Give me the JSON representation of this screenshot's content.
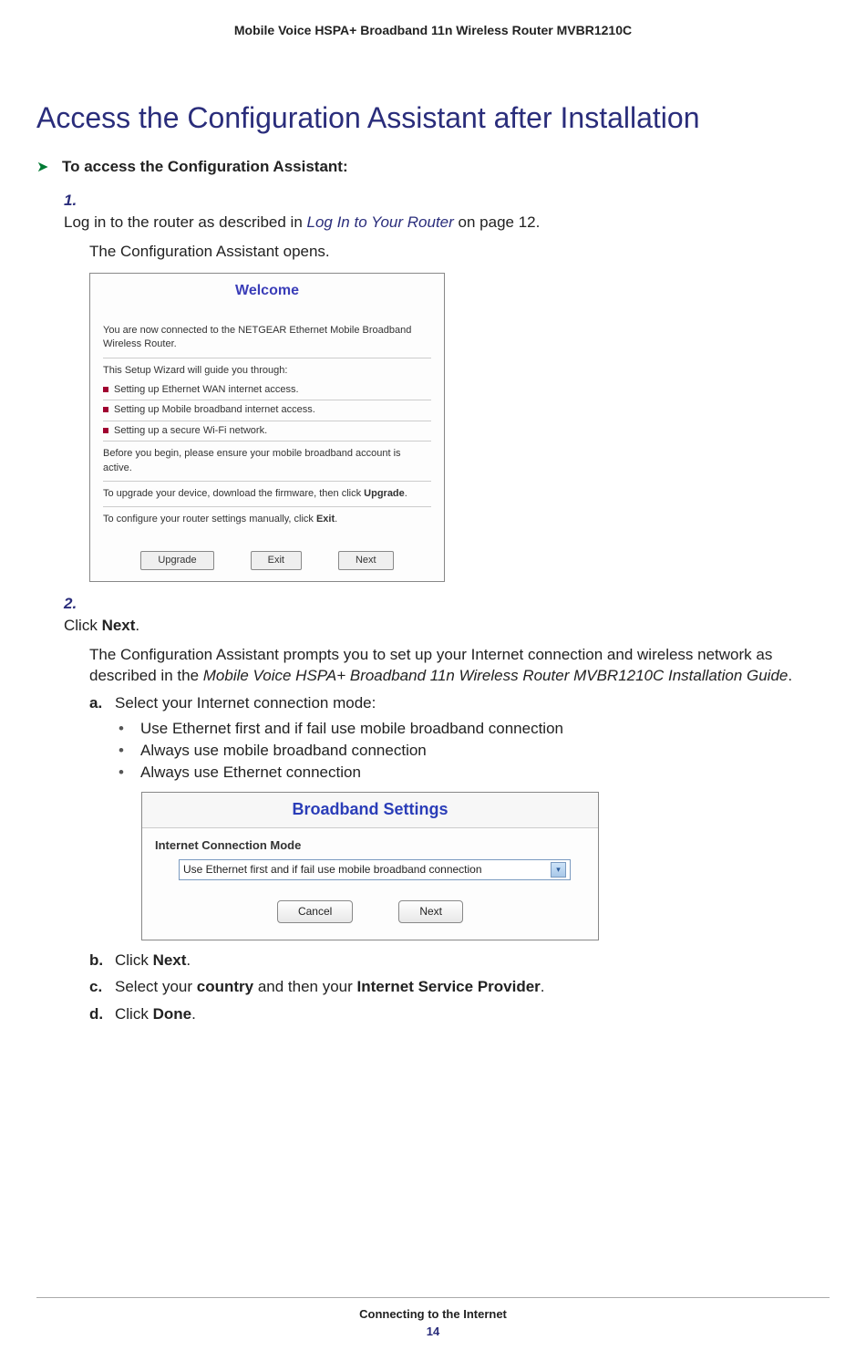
{
  "header": {
    "title": "Mobile Voice HSPA+ Broadband 11n Wireless Router MVBR1210C"
  },
  "heading": "Access the Configuration Assistant after Installation",
  "procedure_intro": "To access the Configuration Assistant:",
  "steps": {
    "one": {
      "num": "1.",
      "text_prefix": "Log in to the router as described in ",
      "link": "Log In to Your Router",
      "text_suffix": " on page 12.",
      "follow": "The Configuration Assistant opens."
    },
    "two": {
      "num": "2.",
      "text_prefix": "Click ",
      "bold": "Next",
      "text_suffix": ".",
      "follow_prefix": "The Configuration Assistant prompts you to set up your Internet connection and wireless network as described in the ",
      "follow_italic": "Mobile Voice HSPA+ Broadband 11n Wireless Router MVBR1210C Installation Guide",
      "follow_suffix": "."
    }
  },
  "welcome_dialog": {
    "title": "Welcome",
    "line1": "You are now connected to the NETGEAR Ethernet Mobile Broadband Wireless Router.",
    "guide_intro": "This Setup Wizard will guide you through:",
    "bullets": [
      "Setting up Ethernet WAN internet access.",
      "Setting up Mobile broadband internet access.",
      "Setting up a secure Wi-Fi network."
    ],
    "before": "Before you begin, please ensure your mobile broadband account is active.",
    "upgrade_line_prefix": "To upgrade your device, download the firmware, then click ",
    "upgrade_bold": "Upgrade",
    "upgrade_suffix": ".",
    "exit_line_prefix": "To configure your router settings manually, click ",
    "exit_bold": "Exit",
    "exit_suffix": ".",
    "buttons": {
      "upgrade": "Upgrade",
      "exit": "Exit",
      "next": "Next"
    }
  },
  "sub_a": {
    "letter": "a.",
    "text": "Select your Internet connection mode:",
    "options": [
      "Use Ethernet first and if fail use mobile broadband connection",
      "Always use mobile broadband connection",
      "Always use Ethernet connection"
    ]
  },
  "broadband_dialog": {
    "title": "Broadband Settings",
    "section": "Internet Connection Mode",
    "selected": "Use Ethernet first and if fail use mobile broadband connection",
    "buttons": {
      "cancel": "Cancel",
      "next": "Next"
    }
  },
  "sub_b": {
    "letter": "b.",
    "prefix": "Click ",
    "bold": "Next",
    "suffix": "."
  },
  "sub_c": {
    "letter": "c.",
    "prefix": "Select your ",
    "bold1": "country",
    "mid": " and then your ",
    "bold2": "Internet Service Provider",
    "suffix": "."
  },
  "sub_d": {
    "letter": "d.",
    "prefix": "Click ",
    "bold": "Done",
    "suffix": "."
  },
  "footer": {
    "chapter": "Connecting to the Internet",
    "page": "14"
  }
}
